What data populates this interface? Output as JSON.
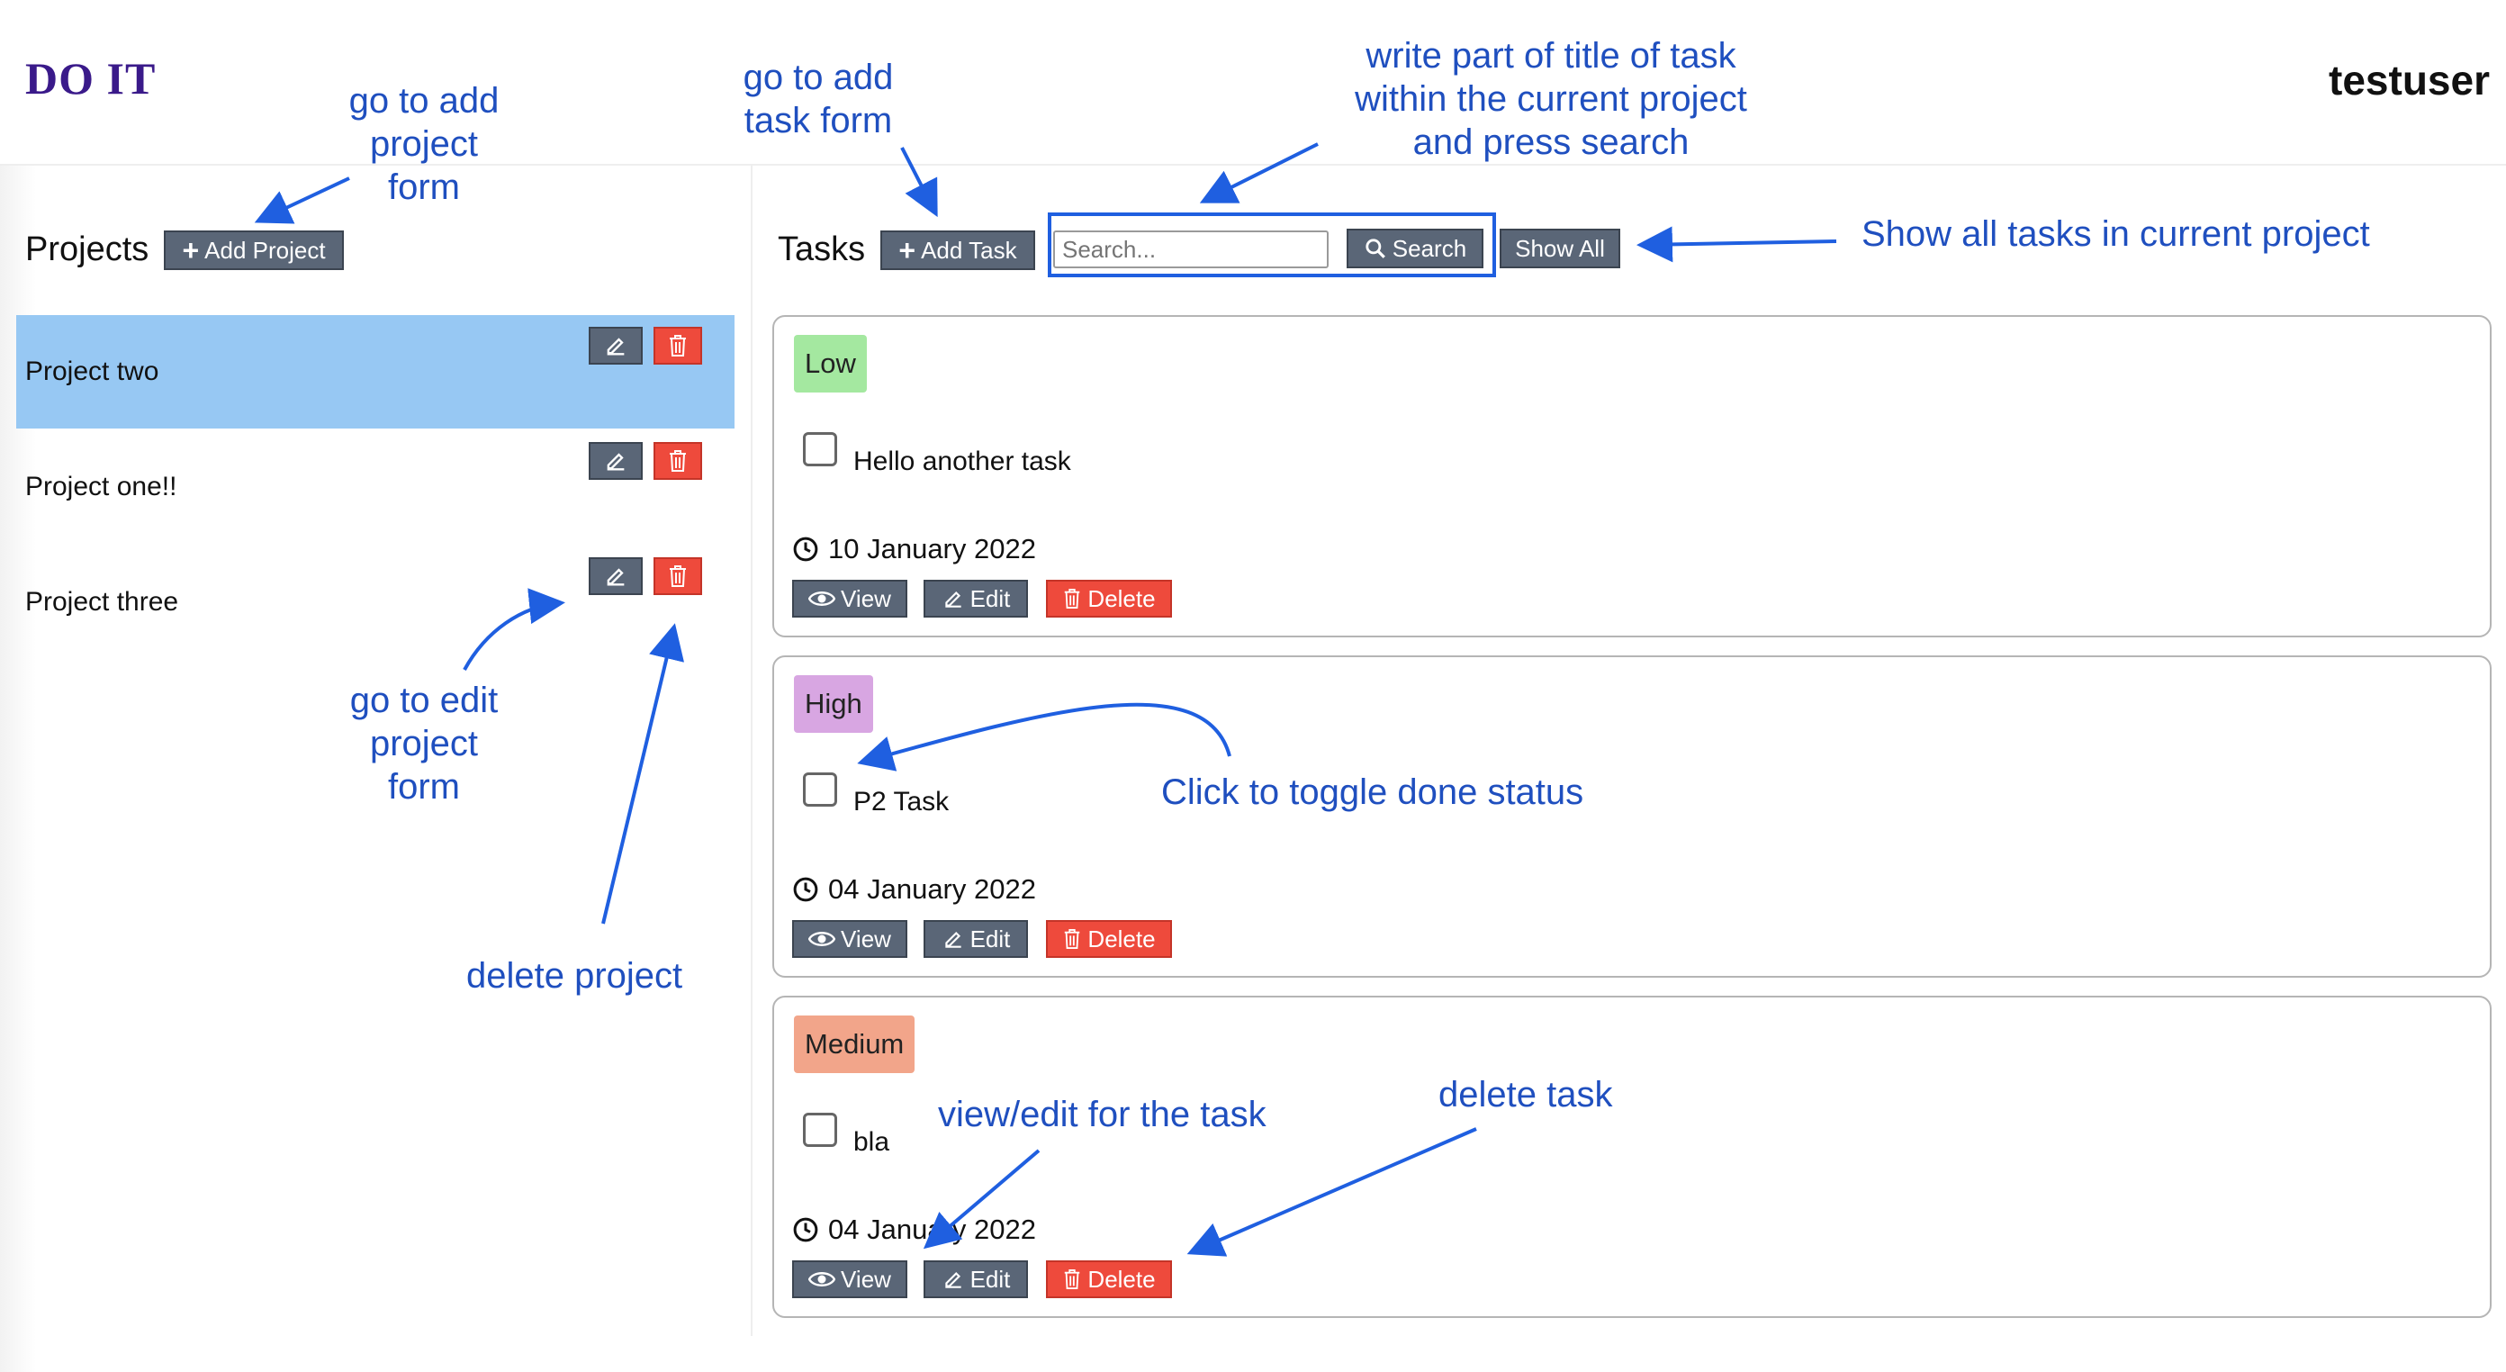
{
  "header": {
    "brand": "DO IT",
    "username": "testuser"
  },
  "projects": {
    "title": "Projects",
    "add_label": "Add Project",
    "items": [
      {
        "name": "Project two",
        "active": true
      },
      {
        "name": "Project one!!",
        "active": false
      },
      {
        "name": "Project three",
        "active": false
      }
    ]
  },
  "tasks": {
    "title": "Tasks",
    "add_label": "Add Task",
    "search_placeholder": "Search...",
    "search_label": "Search",
    "show_all_label": "Show All",
    "items": [
      {
        "priority": "Low",
        "priority_color": "#a4e8a0",
        "title": "Hello another task",
        "date": "10 January 2022",
        "done": false
      },
      {
        "priority": "High",
        "priority_color": "#d8a6e2",
        "title": "P2 Task",
        "date": "04 January 2022",
        "done": false
      },
      {
        "priority": "Medium",
        "priority_color": "#f2a58a",
        "title": "bla",
        "date": "04 January 2022",
        "done": false
      }
    ],
    "view_label": "View",
    "edit_label": "Edit",
    "delete_label": "Delete"
  },
  "annotations": {
    "add_project": [
      "go to add",
      "project",
      "form"
    ],
    "add_task": [
      "go to add",
      "task form"
    ],
    "search": [
      "write part of title of task",
      "within the current project",
      "and press search"
    ],
    "show_all": "Show all tasks in current project",
    "edit_project": [
      "go to edit",
      "project",
      "form"
    ],
    "delete_project": "delete project",
    "toggle_done": "Click to toggle done status",
    "view_edit_task": "view/edit for the task",
    "delete_task": "delete task"
  },
  "colors": {
    "brand": "#3a1a8a",
    "active_project": "#97c8f3",
    "button_dark": "#5a6677",
    "button_danger": "#ee4a3c",
    "annotation": "#1f4fbf",
    "search_highlight": "#1f5fe0"
  },
  "icons": {
    "add": "plus-icon",
    "edit": "edit-icon",
    "delete": "trash-icon",
    "search": "search-icon",
    "view": "eye-icon",
    "date": "clock-icon"
  }
}
